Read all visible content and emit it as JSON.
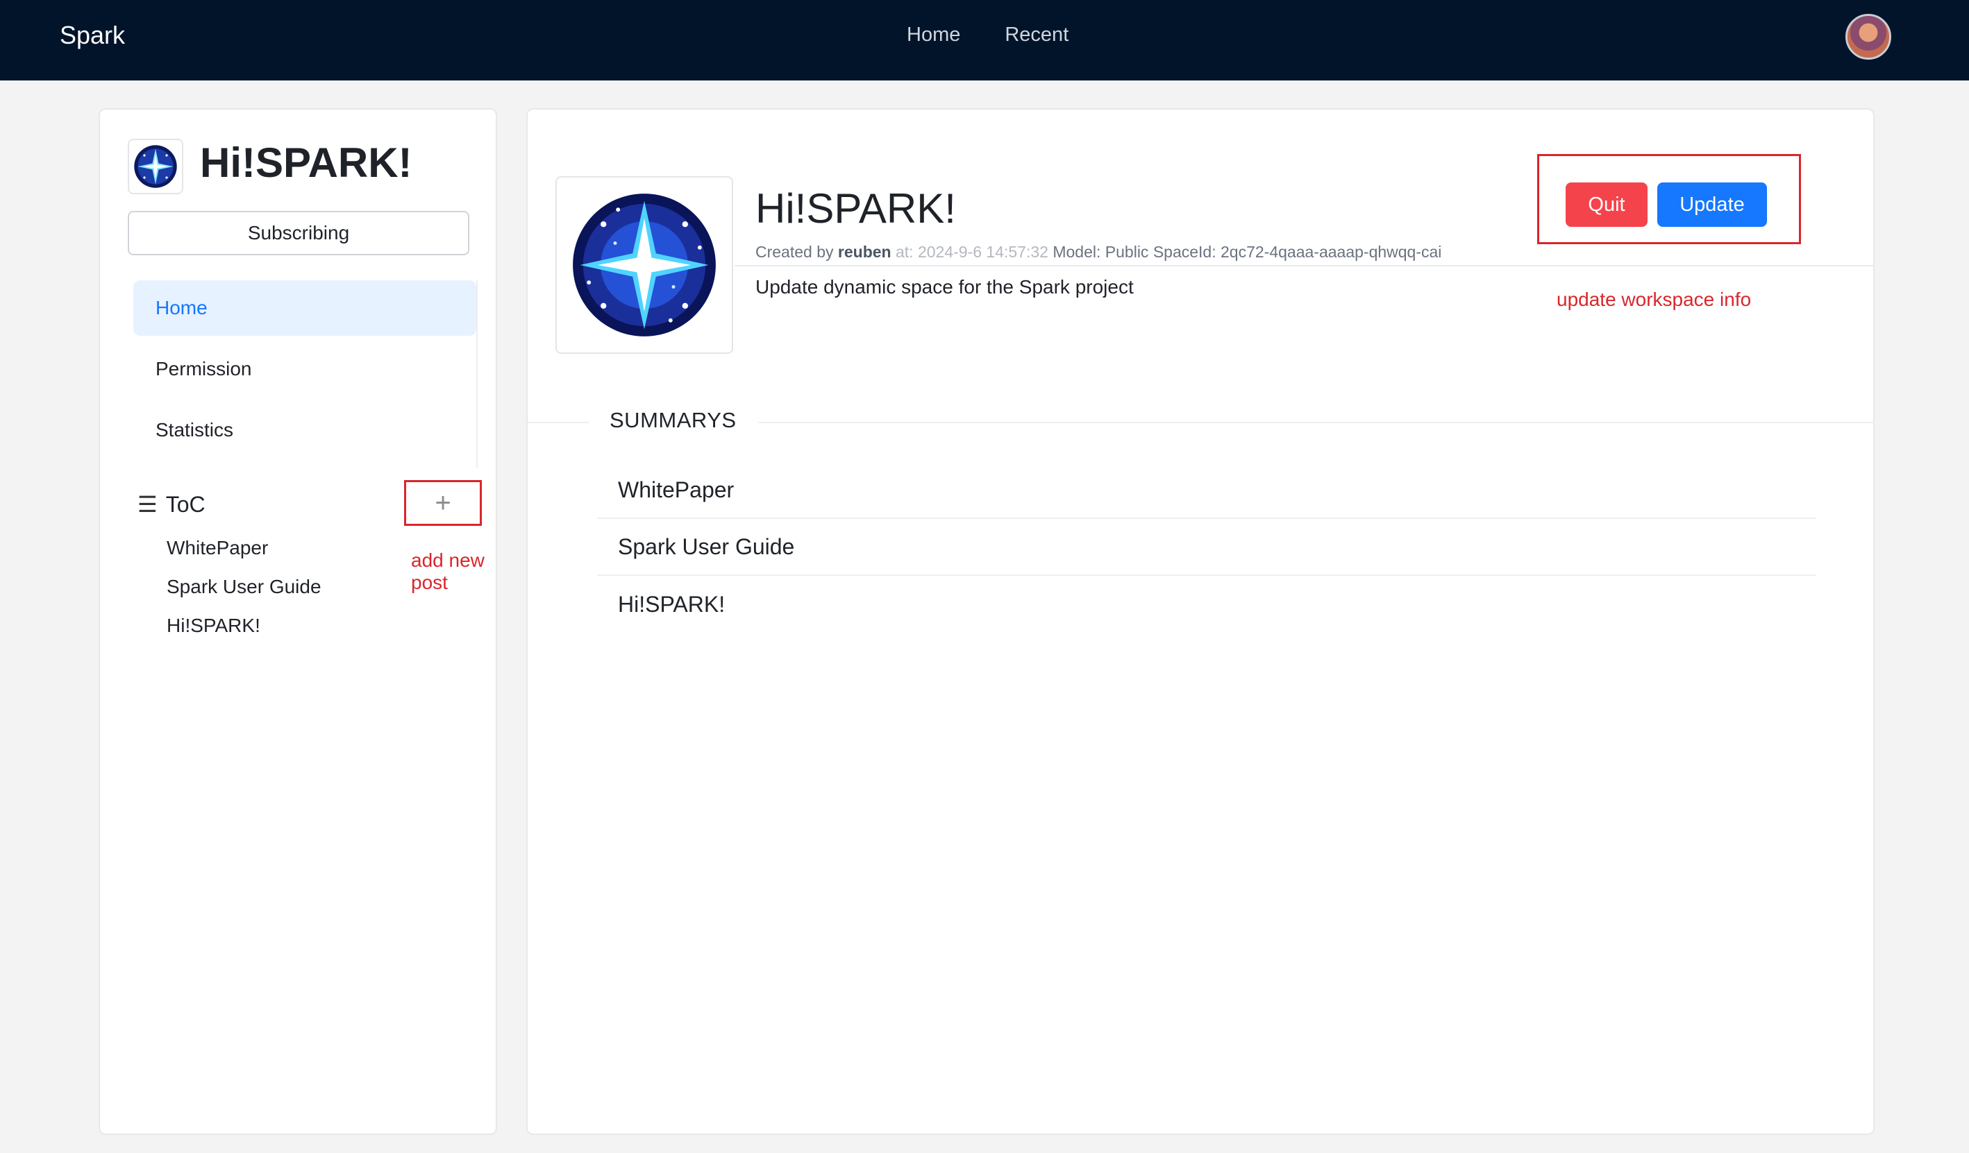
{
  "topbar": {
    "brand": "Spark",
    "nav": [
      "Home",
      "Recent"
    ]
  },
  "sidebar": {
    "title": "Hi!SPARK!",
    "subscribe_label": "Subscribing",
    "menu": [
      "Home",
      "Permission",
      "Statistics"
    ],
    "toc_label": "ToC",
    "toc_items": [
      "WhitePaper",
      "Spark User Guide",
      "Hi!SPARK!"
    ],
    "annotation": "add new post"
  },
  "main": {
    "title": "Hi!SPARK!",
    "meta": {
      "created_by_label": "Created by",
      "author": "reuben",
      "at_label": "at:",
      "created_at": "2024-9-6 14:57:32",
      "model_label": "Model:",
      "model": "Public",
      "space_id_label": "SpaceId:",
      "space_id": "2qc72-4qaaa-aaaap-qhwqq-cai"
    },
    "description": "Update dynamic space for the Spark project",
    "quit_label": "Quit",
    "update_label": "Update",
    "annotation": "update workspace info",
    "summaries_title": "SUMMARYS",
    "summaries": [
      "WhitePaper",
      "Spark User Guide",
      "Hi!SPARK!"
    ]
  },
  "colors": {
    "topbar": "#02142a",
    "primary": "#1677ff",
    "danger": "#f5434b",
    "annotation": "#d9262c",
    "active_bg": "#e6f2ff"
  },
  "icons": [
    "menu-icon",
    "plus-icon",
    "star-logo-icon",
    "user-avatar"
  ]
}
